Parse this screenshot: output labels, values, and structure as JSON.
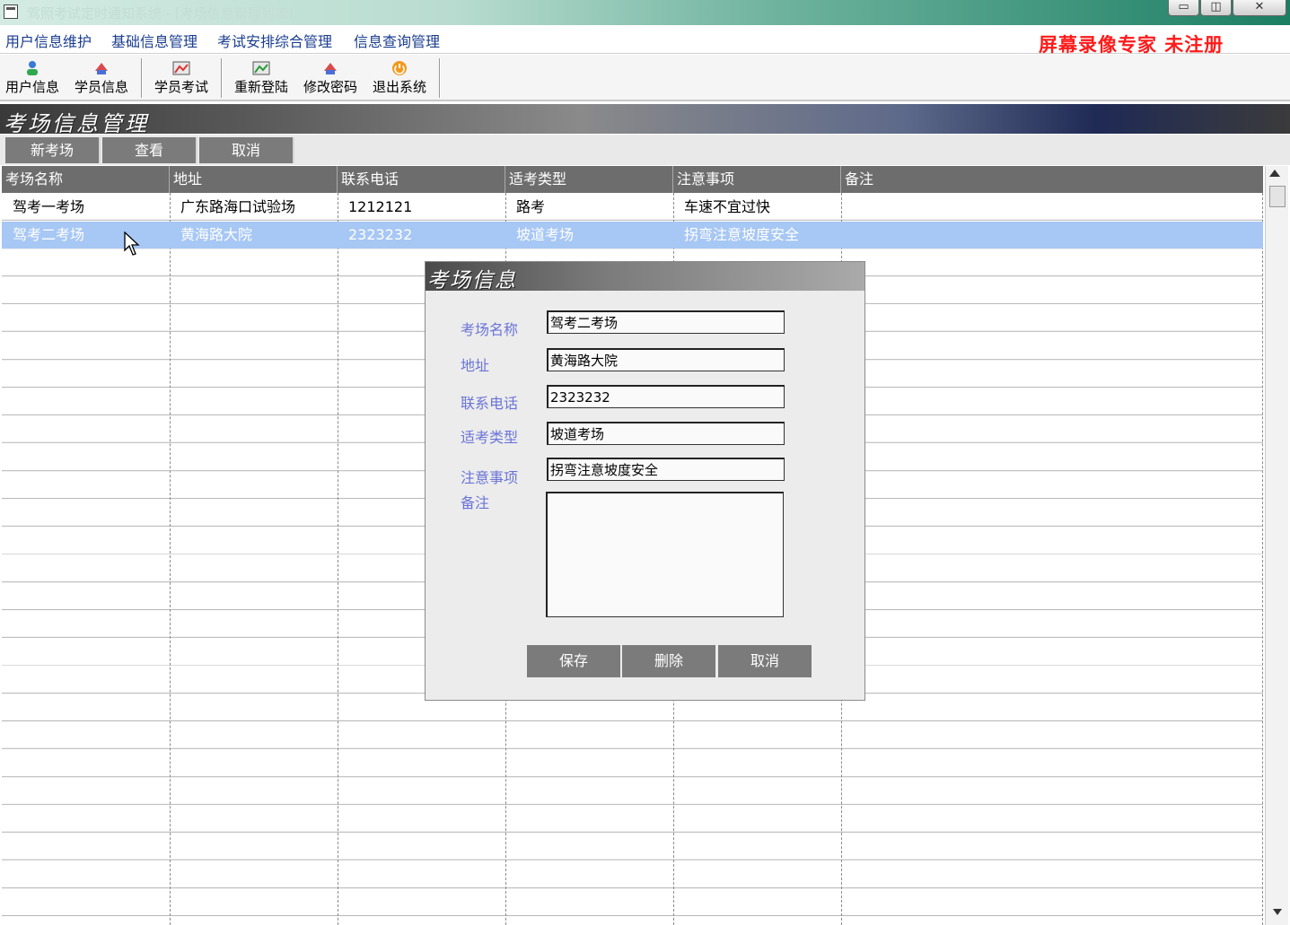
{
  "window": {
    "title": "驾照考试定时通知系统 - [考场信息管理列表]",
    "controls": [
      "▭",
      "◫",
      "✕"
    ]
  },
  "menu": [
    "用户信息维护",
    "基础信息管理",
    "考试安排综合管理",
    "信息查询管理"
  ],
  "watermark": "屏幕录像专家  未注册",
  "toolbar": [
    {
      "label": "用户信息",
      "icon": "user-icon"
    },
    {
      "label": "学员信息",
      "icon": "student-icon"
    },
    {
      "label": "学员考试",
      "icon": "exam-icon"
    },
    {
      "label": "重新登陆",
      "icon": "relogin-icon"
    },
    {
      "label": "修改密码",
      "icon": "password-icon"
    },
    {
      "label": "退出系统",
      "icon": "exit-icon"
    }
  ],
  "section_title": "考场信息管理",
  "actions": [
    "新考场",
    "查看",
    "取消"
  ],
  "table": {
    "columns": [
      "考场名称",
      "地址",
      "联系电话",
      "适考类型",
      "注意事项",
      "备注"
    ],
    "rows": [
      [
        "驾考一考场",
        "广东路海口试验场",
        "1212121",
        "路考",
        "车速不宜过快",
        ""
      ],
      [
        "驾考二考场",
        "黄海路大院",
        "2323232",
        "坡道考场",
        "拐弯注意坡度安全",
        ""
      ]
    ],
    "selected_row": 1
  },
  "dialog": {
    "title": "考场信息",
    "labels": {
      "name": "考场名称",
      "address": "地址",
      "phone": "联系电话",
      "type": "适考类型",
      "notes": "注意事项",
      "remark": "备注"
    },
    "values": {
      "name": "驾考二考场",
      "address": "黄海路大院",
      "phone": "2323232",
      "type": "坡道考场",
      "notes": "拐弯注意坡度安全",
      "remark": ""
    },
    "buttons": {
      "save": "保存",
      "delete": "删除",
      "cancel": "取消"
    }
  },
  "colors": {
    "menu_text": "#1a3d8f",
    "watermark": "#ff1a1a",
    "header_bg": "#6d6d6d",
    "selected_row": "#a7c7f4",
    "button_bg": "#7b7b7b",
    "dialog_label": "#6a74d8"
  }
}
